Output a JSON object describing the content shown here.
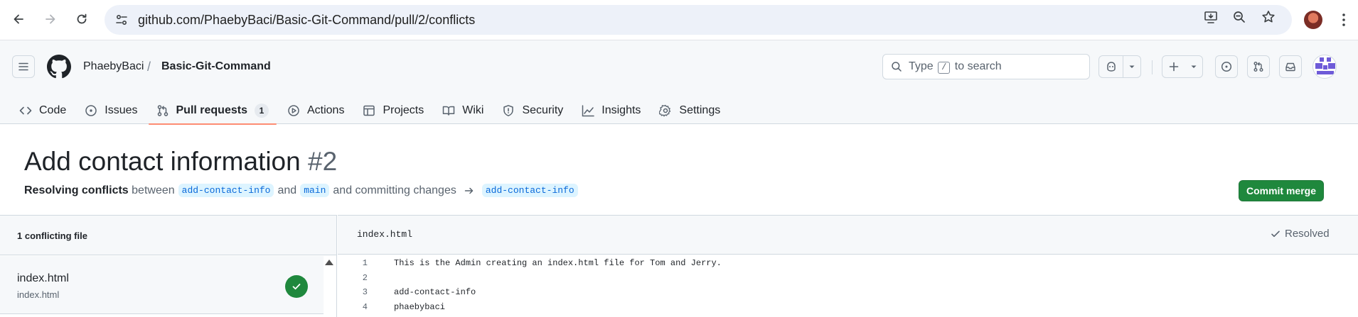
{
  "browser": {
    "url": "github.com/PhaebyBaci/Basic-Git-Command/pull/2/conflicts"
  },
  "header": {
    "owner": "PhaebyBaci",
    "separator": "/",
    "repo": "Basic-Git-Command",
    "search": {
      "pre": "Type",
      "key": "/",
      "post": "to search"
    }
  },
  "tabs": [
    {
      "label": "Code",
      "icon": "code-icon"
    },
    {
      "label": "Issues",
      "icon": "issue-icon"
    },
    {
      "label": "Pull requests",
      "icon": "pull-request-icon",
      "count": "1",
      "active": true
    },
    {
      "label": "Actions",
      "icon": "play-icon"
    },
    {
      "label": "Projects",
      "icon": "table-icon"
    },
    {
      "label": "Wiki",
      "icon": "book-icon"
    },
    {
      "label": "Security",
      "icon": "shield-icon"
    },
    {
      "label": "Insights",
      "icon": "graph-icon"
    },
    {
      "label": "Settings",
      "icon": "gear-icon"
    }
  ],
  "pr": {
    "title": "Add contact information",
    "number": "#2",
    "resolving": "Resolving conflicts",
    "between": "between",
    "head_branch": "add-contact-info",
    "and": "and",
    "base_branch": "main",
    "committing": "and committing changes",
    "target_branch": "add-contact-info",
    "commit_label": "Commit merge"
  },
  "sidebar": {
    "header": "1 conflicting file",
    "files": [
      {
        "name": "index.html",
        "path": "index.html",
        "resolved": true
      }
    ]
  },
  "editor": {
    "filename": "index.html",
    "status": "Resolved",
    "lines": [
      {
        "n": "1",
        "text": "This is the Admin creating an index.html file for Tom and Jerry."
      },
      {
        "n": "2",
        "text": ""
      },
      {
        "n": "3",
        "text": "add-contact-info"
      },
      {
        "n": "4",
        "text": "phaebybaci"
      }
    ]
  },
  "colors": {
    "primary_button": "#1f883d",
    "active_tab_underline": "#fd8c73",
    "branch_bg": "#ddf4ff",
    "branch_text": "#0969da"
  }
}
